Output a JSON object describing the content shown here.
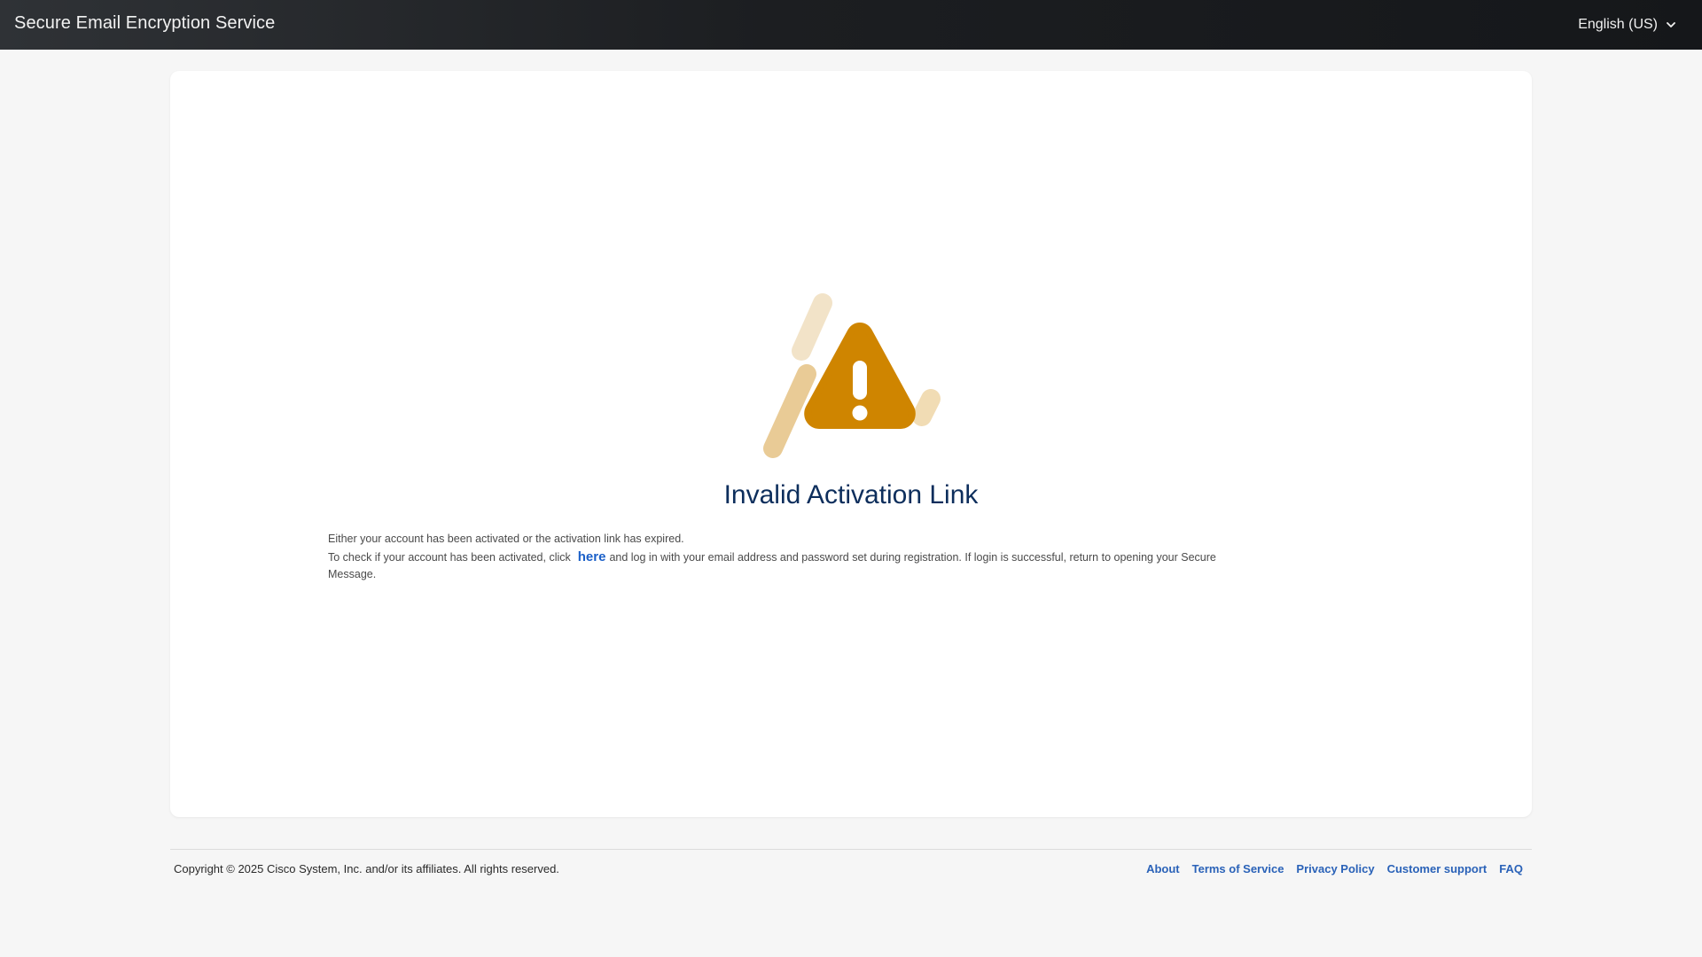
{
  "header": {
    "app_title": "Secure Email Encryption Service",
    "language": "English (US)",
    "language_icon": "chevron-down-icon"
  },
  "main": {
    "illustration_icon": "warning-triangle-icon",
    "heading": "Invalid Activation Link",
    "line1": "Either your account has been activated or the activation link has expired.",
    "line2_before": "To check if your account has been activated, click",
    "link_text": "here",
    "line2_after": "and log in with your email address and password set during registration. If login is successful, return to opening your Secure Message."
  },
  "footer": {
    "copyright": "Copyright © 2025 Cisco System, Inc. and/or its affiliates. All rights reserved.",
    "links": [
      "About",
      "Terms of Service",
      "Privacy Policy",
      "Customer support",
      "FAQ"
    ]
  },
  "colors": {
    "warning_accent": "#cf8500",
    "heading": "#0d2e5c",
    "link": "#1a5fc8",
    "header_bg": "#1c1e21"
  }
}
